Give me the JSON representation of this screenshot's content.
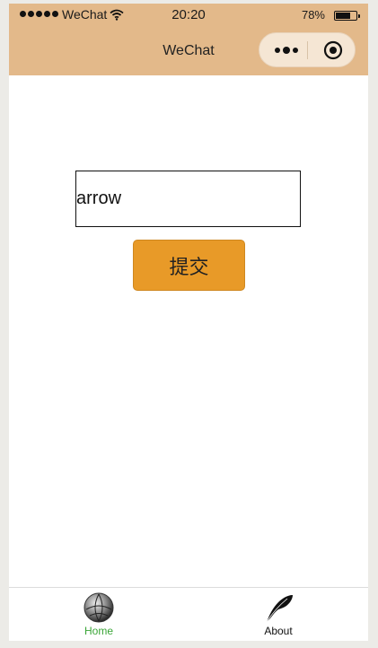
{
  "status_bar": {
    "carrier": "WeChat",
    "time": "20:20",
    "battery_percent_label": "78%",
    "battery_level": 0.78,
    "signal_icon": "signal-dots-icon",
    "wifi_icon": "wifi-icon",
    "battery_icon": "battery-icon"
  },
  "nav": {
    "title": "WeChat",
    "menu_icon": "more-dots-icon",
    "close_icon": "target-circle-icon"
  },
  "form": {
    "input_value": "arrow",
    "submit_label": "提交"
  },
  "tabs": [
    {
      "label": "Home",
      "icon": "globe-icon",
      "active": true
    },
    {
      "label": "About",
      "icon": "feather-icon",
      "active": false
    }
  ],
  "colors": {
    "header_bg": "#e3b98a",
    "submit_bg": "#e89a28",
    "active_tab": "#3aa537",
    "inactive_tab": "#111111"
  }
}
